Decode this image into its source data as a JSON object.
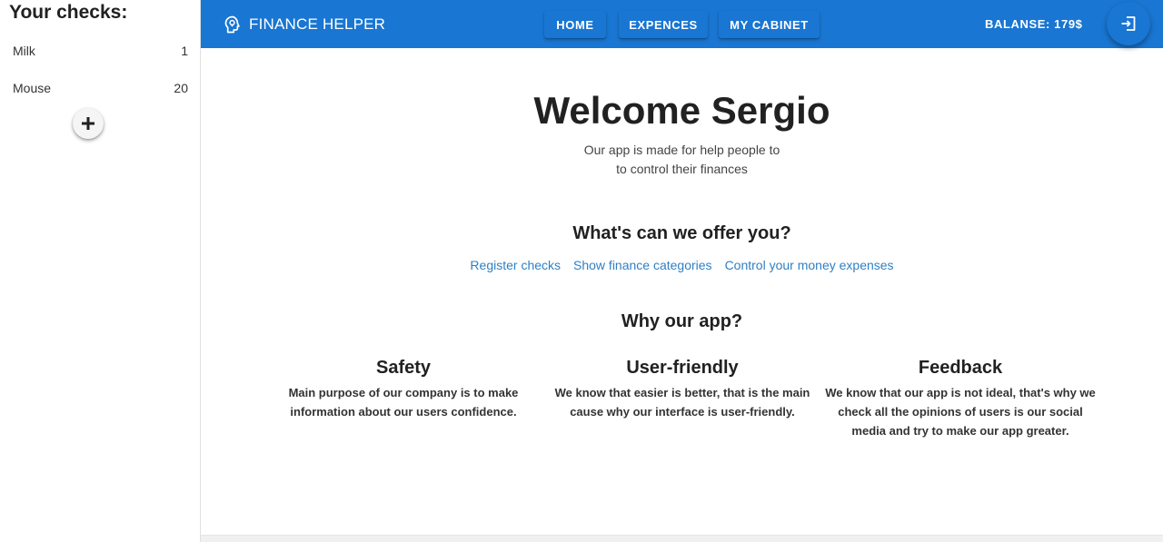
{
  "sidebar": {
    "title": "Your checks:",
    "checks": [
      {
        "name": "Milk",
        "amount": "1"
      },
      {
        "name": "Mouse",
        "amount": "20"
      }
    ],
    "add_icon": "plus-icon"
  },
  "header": {
    "brand_name": "FINANCE HELPER",
    "brand_icon": "head-lightbulb-icon",
    "nav": [
      {
        "label": "HOME"
      },
      {
        "label": "EXPENCES"
      },
      {
        "label": "MY CABINET"
      }
    ],
    "balance": "BALANSE: 179$",
    "logout_icon": "logout-icon",
    "color": "#1976d2"
  },
  "main": {
    "welcome": "Welcome Sergio",
    "intro_line1": "Our app is made for help people to",
    "intro_line2": "to control their finances",
    "offer_title": "What's can we offer you?",
    "offer_links": [
      "Register checks",
      "Show finance categories",
      "Control your money expenses"
    ],
    "why_title": "Why our app?",
    "features": [
      {
        "title": "Safety",
        "text": "Main purpose of our company is to make information about our users confidence."
      },
      {
        "title": "User-friendly",
        "text": "We know that easier is better, that is the main cause why our interface is user-friendly."
      },
      {
        "title": "Feedback",
        "text": "We know that our app is not ideal, that's why we check all the opinions of users is our social media and try to make our app greater."
      }
    ],
    "link_color": "#2f7fc4"
  }
}
